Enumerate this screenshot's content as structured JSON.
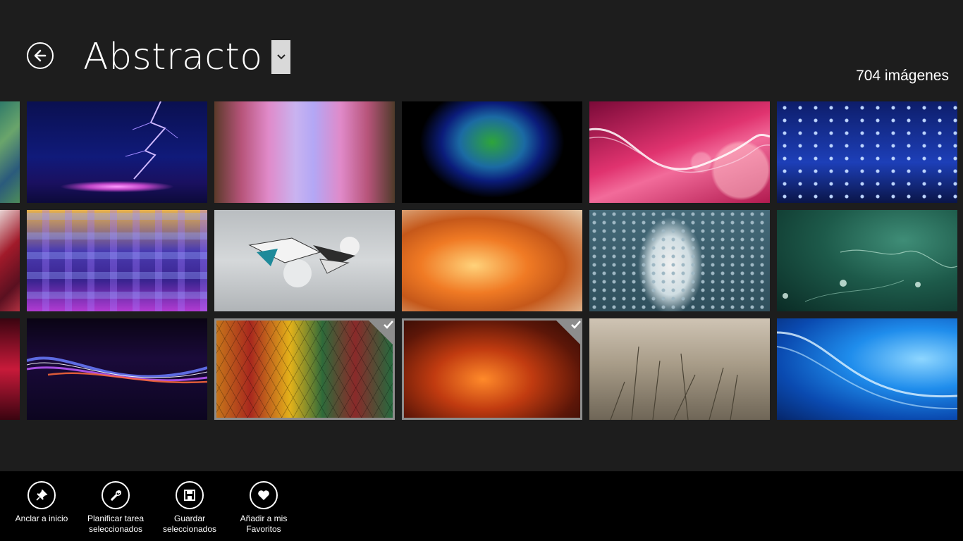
{
  "header": {
    "title": "Abstracto",
    "count_label": "704 imágenes"
  },
  "gallery": {
    "rows": [
      [
        "Green abstract (partial)",
        "Lightning on blue",
        "Pink waterfall",
        "Green and blue powder explosion",
        "Pink waves with bokeh",
        "Blue water drops"
      ],
      [
        "Red abstract (partial)",
        "Colorful squares bokeh",
        "Grey 3D shards",
        "Orange blurred abstract",
        "Paper pieces human figure",
        "Water drops on green"
      ],
      [
        "Red waves (partial)",
        "Purple light waves",
        "Triangle mosaic",
        "Orange fire abstract",
        "Grass close-up",
        "Blue swirl"
      ]
    ],
    "selected": [
      "Triangle mosaic",
      "Orange fire abstract"
    ]
  },
  "appbar": {
    "commands": [
      {
        "label": "Anclar a inicio",
        "icon": "pin-icon"
      },
      {
        "label": "Planificar tarea\nseleccionados",
        "icon": "wrench-icon"
      },
      {
        "label": "Guardar\nseleccionados",
        "icon": "save-icon"
      },
      {
        "label": "Añadir a mis\nFavoritos",
        "icon": "heart-icon"
      }
    ]
  },
  "colors": {
    "background": "#1d1d1d",
    "appbar": "#000000",
    "selection": "#8d8d8d"
  }
}
